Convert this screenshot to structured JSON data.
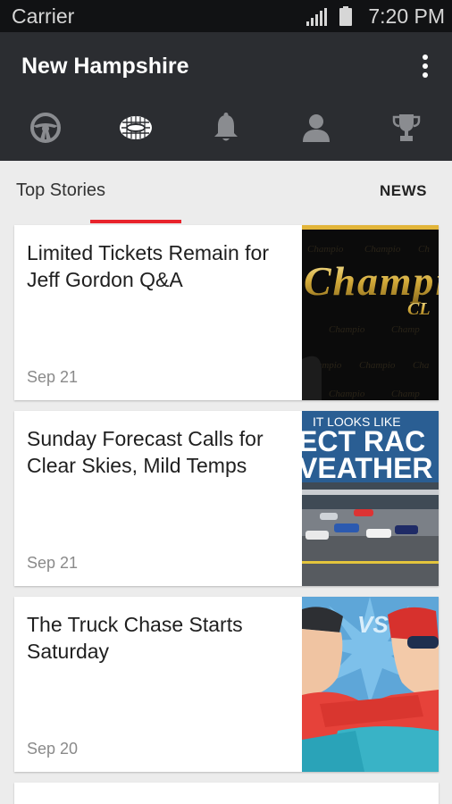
{
  "status_bar": {
    "carrier": "Carrier",
    "time": "7:20 PM"
  },
  "app_bar": {
    "title": "New Hampshire",
    "menu_icon": "more-vertical-icon"
  },
  "tabs": [
    {
      "icon": "steering-wheel-icon",
      "selected": false
    },
    {
      "icon": "speedway-icon",
      "selected": true
    },
    {
      "icon": "bell-icon",
      "selected": false
    },
    {
      "icon": "person-icon",
      "selected": false
    },
    {
      "icon": "trophy-icon",
      "selected": false
    }
  ],
  "section": {
    "title": "Top Stories",
    "link": "NEWS"
  },
  "stories": [
    {
      "headline": "Limited Tickets Remain for Jeff Gordon Q&A",
      "date": "Sep 21",
      "thumb_text": [
        "Champi",
        "CL"
      ]
    },
    {
      "headline": "Sunday Forecast Calls for Clear Skies, Mild Temps",
      "date": "Sep 21",
      "thumb_text": [
        "IT LOOKS LIKE",
        "ECT RAC",
        "VEATHER"
      ]
    },
    {
      "headline": "The Truck Chase Starts Saturday",
      "date": "Sep 20",
      "thumb_text": [
        "VS"
      ]
    }
  ],
  "colors": {
    "accent": "#e8232b",
    "app_bar": "#2b2d31",
    "status_bar": "#111214",
    "background": "#ececec",
    "tab_icon": "#8a8c90"
  }
}
